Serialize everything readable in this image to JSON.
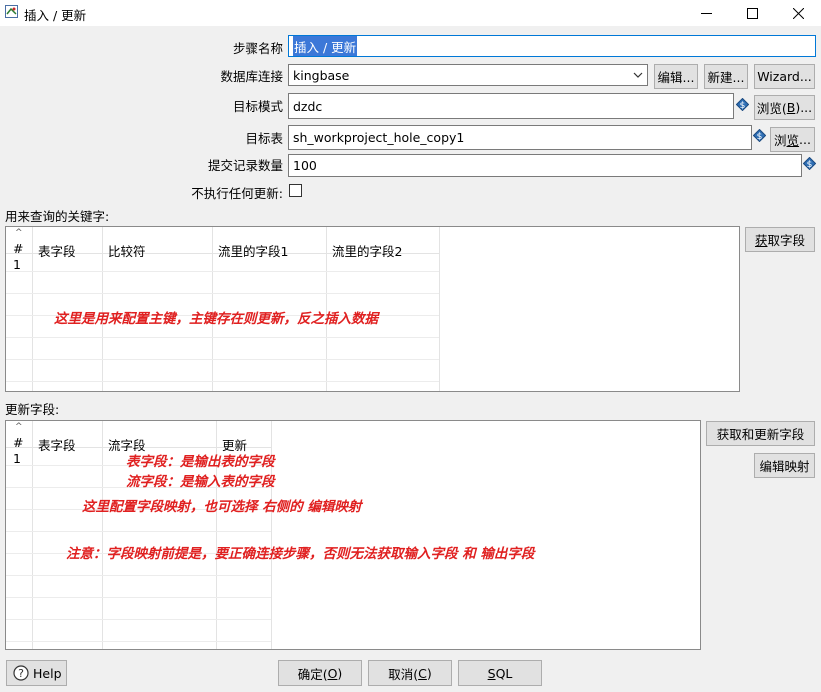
{
  "window": {
    "title": "插入 / 更新",
    "controls": {
      "minimize_icon": "minimize-icon",
      "maximize_icon": "maximize-icon",
      "close_icon": "close-icon"
    }
  },
  "form": {
    "step_name": {
      "label": "步骤名称",
      "value": "插入 / 更新"
    },
    "connection": {
      "label": "数据库连接",
      "value": "kingbase",
      "edit_label": "编辑...",
      "new_label": "新建...",
      "wizard_label": "Wizard..."
    },
    "schema": {
      "label": "目标模式",
      "value": "dzdc",
      "browse_label_pre": "浏览(",
      "browse_key": "B",
      "browse_label_post": ")..."
    },
    "table": {
      "label": "目标表",
      "value": "sh_workproject_hole_copy1",
      "browse_label_pre": "浏",
      "browse_key": "览",
      "browse_label_post": "..."
    },
    "commit_size": {
      "label": "提交记录数量",
      "value": "100"
    },
    "no_update": {
      "label": "不执行任何更新:",
      "checked": false
    }
  },
  "key_section": {
    "label": "用来查询的关键字:",
    "columns": [
      "#",
      "表字段",
      "比较符",
      "流里的字段1",
      "流里的字段2"
    ],
    "rows": [
      [
        "1",
        "",
        "",
        "",
        ""
      ]
    ],
    "get_fields_pre": "",
    "get_fields_key": "获",
    "get_fields_post": "取字段",
    "annotation": "这里是用来配置主键，主键存在则更新，反之插入数据"
  },
  "update_section": {
    "label": "更新字段:",
    "columns": [
      "#",
      "表字段",
      "流字段",
      "更新"
    ],
    "rows": [
      [
        "1",
        "",
        "",
        ""
      ]
    ],
    "get_update_fields_label": "获取和更新字段",
    "edit_mapping_label": "编辑映射",
    "annotations": [
      "表字段：是输出表的字段",
      "流字段：是输入表的字段",
      "这里配置字段映射，也可选择 右侧的 编辑映射",
      "注意：字段映射前提是，要正确连接步骤，否则无法获取输入字段 和 输出字段"
    ]
  },
  "footer": {
    "help_label": "Help",
    "ok_pre": "确定(",
    "ok_key": "O",
    "ok_post": ")",
    "cancel_pre": "取消(",
    "cancel_key": "C",
    "cancel_post": ")",
    "sql_key": "S",
    "sql_post": "QL"
  },
  "colors": {
    "accent": "#0078d7",
    "annotation": "#e02020",
    "selection": "#3c78d8"
  }
}
